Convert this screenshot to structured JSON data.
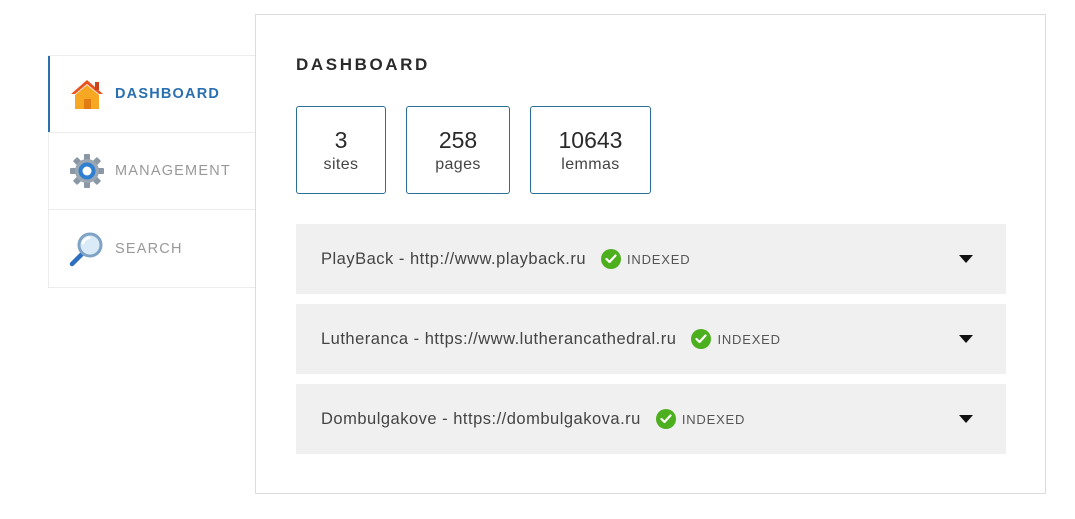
{
  "sidebar": {
    "items": [
      {
        "label": "DASHBOARD",
        "icon": "home-icon",
        "active": true
      },
      {
        "label": "MANAGEMENT",
        "icon": "gear-icon",
        "active": false
      },
      {
        "label": "SEARCH",
        "icon": "magnifier-icon",
        "active": false
      }
    ]
  },
  "main": {
    "title": "DASHBOARD",
    "stats": [
      {
        "value": "3",
        "label": "sites"
      },
      {
        "value": "258",
        "label": "pages"
      },
      {
        "value": "10643",
        "label": "lemmas"
      }
    ],
    "sites": [
      {
        "name": "PlayBack - http://www.playback.ru",
        "status": "INDEXED"
      },
      {
        "name": "Lutheranca - https://www.lutherancathedral.ru",
        "status": "INDEXED"
      },
      {
        "name": "Dombulgakove - https://dombulgakova.ru",
        "status": "INDEXED"
      }
    ]
  },
  "colors": {
    "accent": "#2a6fb0",
    "stat_border": "#2a6f97",
    "status_ok": "#4caf1e",
    "row_bg": "#f0f0f0"
  }
}
